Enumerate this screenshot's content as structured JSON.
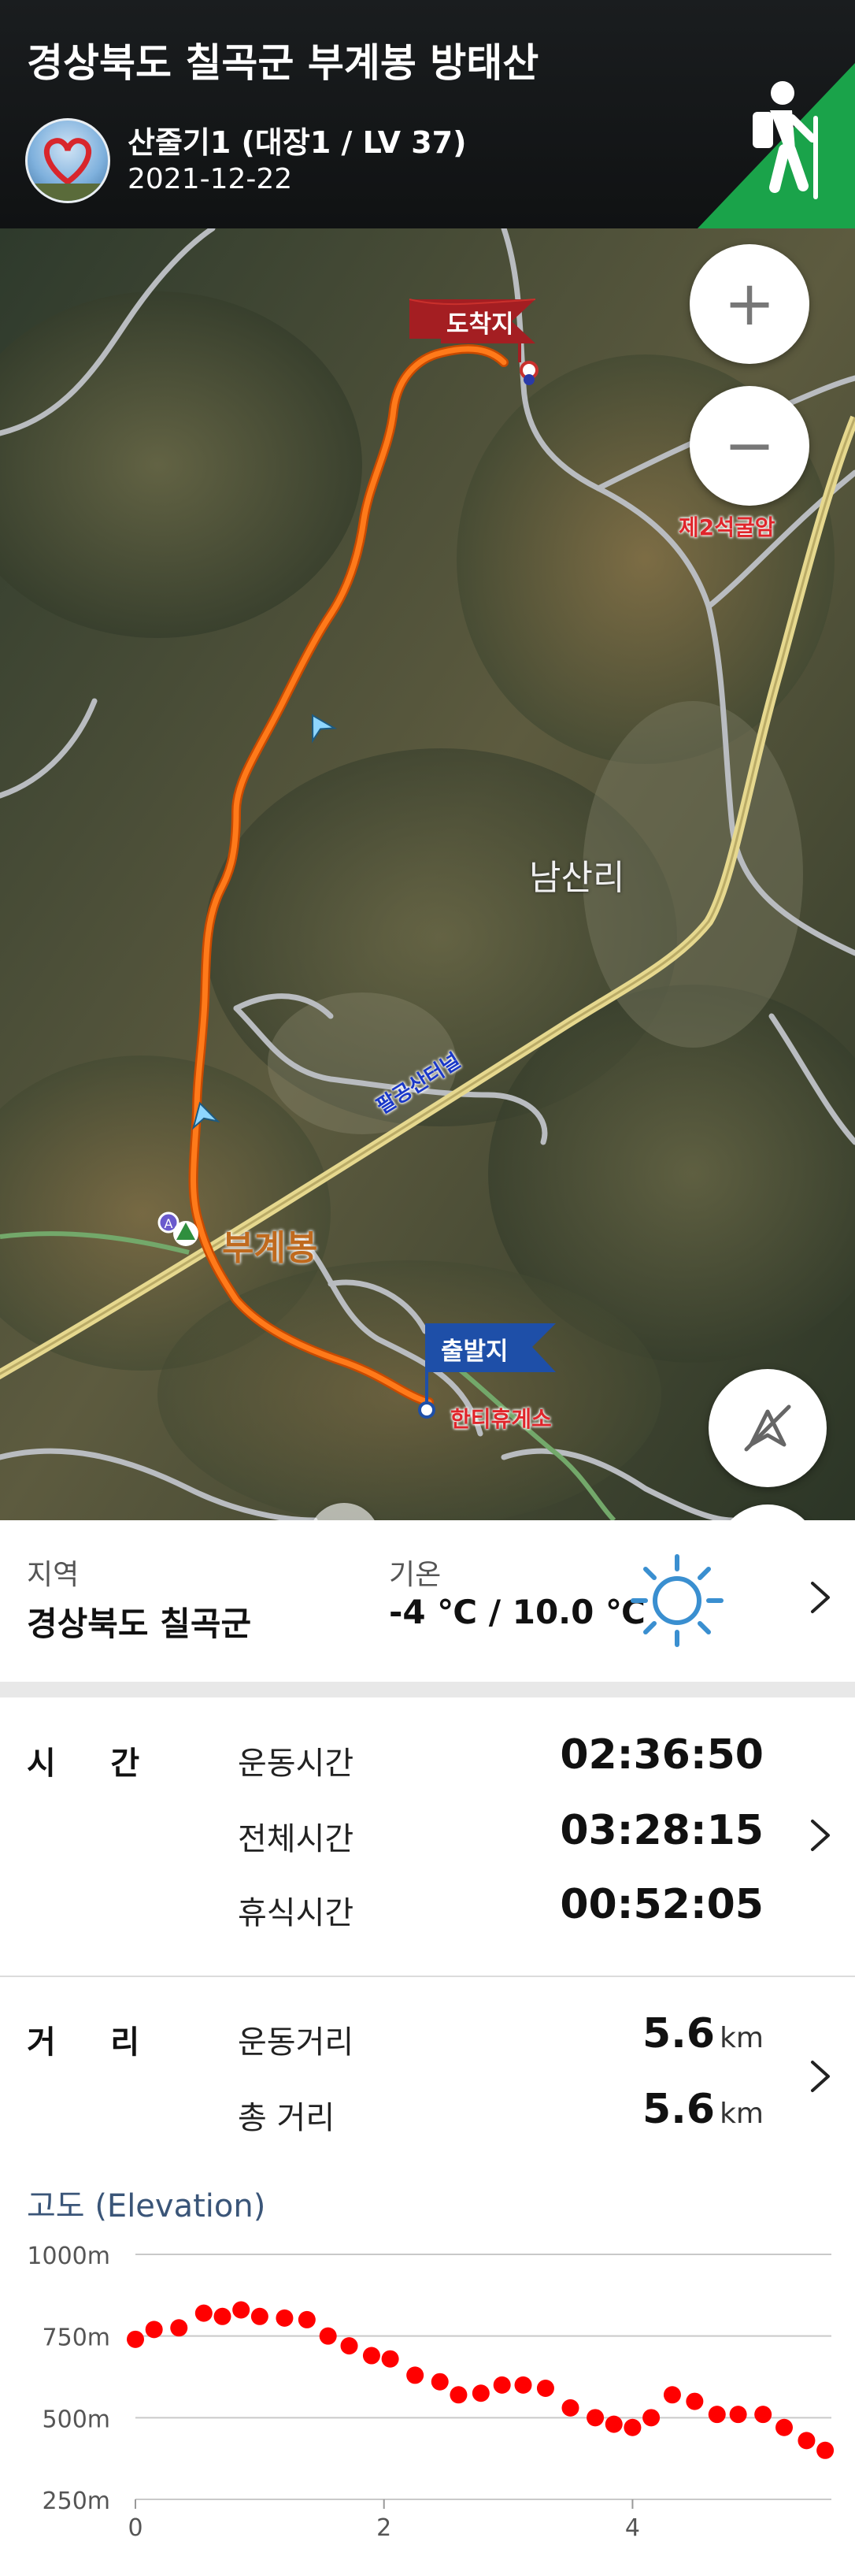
{
  "header": {
    "title": "경상북도 칠곡군 부계봉 방태산",
    "user_name": "산줄기1 (대장1 / LV 37)",
    "date": "2021-12-22",
    "badge_icon": "hiker-icon",
    "badge_color": "#1aa34a"
  },
  "map": {
    "zoom_in": "+",
    "zoom_out": "−",
    "end_flag": "도착지",
    "start_flag": "출발지",
    "labels": {
      "rock": "제2석굴암",
      "village": "남산리",
      "tunnel": "팔공산터널",
      "peak": "부계봉",
      "rest_area": "한티휴게소"
    },
    "route_color": "#ff6a13",
    "compass_icon": "compass-off-icon"
  },
  "info": {
    "region_label": "지역",
    "region_value": "경상북도 칠곡군",
    "temp_label": "기온",
    "temp_value": "-4 ℃ / 10.0 ℃",
    "weather_icon": "sun-icon"
  },
  "time": {
    "header": "시     간",
    "rows": [
      {
        "label": "운동시간",
        "value": "02:36:50"
      },
      {
        "label": "전체시간",
        "value": "03:28:15"
      },
      {
        "label": "휴식시간",
        "value": "00:52:05"
      }
    ]
  },
  "distance": {
    "header": "거     리",
    "unit": "km",
    "rows": [
      {
        "label": "운동거리",
        "value": "5.6"
      },
      {
        "label": "총 거리",
        "value": "5.6"
      }
    ]
  },
  "elevation": {
    "title": "고도 (Elevation)"
  },
  "chart_data": {
    "type": "scatter",
    "title": "고도 (Elevation)",
    "ylim": [
      250,
      1000
    ],
    "xlim": [
      0,
      5.6
    ],
    "y_ticks": [
      "1000m",
      "750m",
      "500m",
      "250m"
    ],
    "y_tick_values": [
      1000,
      750,
      500,
      250
    ],
    "x_ticks": [
      "0",
      "2",
      "4"
    ],
    "x_tick_values": [
      0,
      2,
      4
    ],
    "color": "#ff0000",
    "series": [
      {
        "x": [
          0.0,
          0.15,
          0.35,
          0.55,
          0.7,
          0.85,
          1.0,
          1.2,
          1.38,
          1.55,
          1.72,
          1.9,
          2.05,
          2.25,
          2.45,
          2.6,
          2.78,
          2.95,
          3.12,
          3.3,
          3.5,
          3.7,
          3.85,
          4.0,
          4.15,
          4.32,
          4.5,
          4.68,
          4.85,
          5.05,
          5.22,
          5.4,
          5.55
        ],
        "y": [
          740,
          770,
          775,
          820,
          810,
          830,
          810,
          805,
          800,
          750,
          720,
          690,
          680,
          630,
          610,
          570,
          575,
          600,
          600,
          590,
          530,
          500,
          480,
          470,
          500,
          570,
          550,
          510,
          510,
          510,
          470,
          430,
          400
        ]
      }
    ]
  }
}
